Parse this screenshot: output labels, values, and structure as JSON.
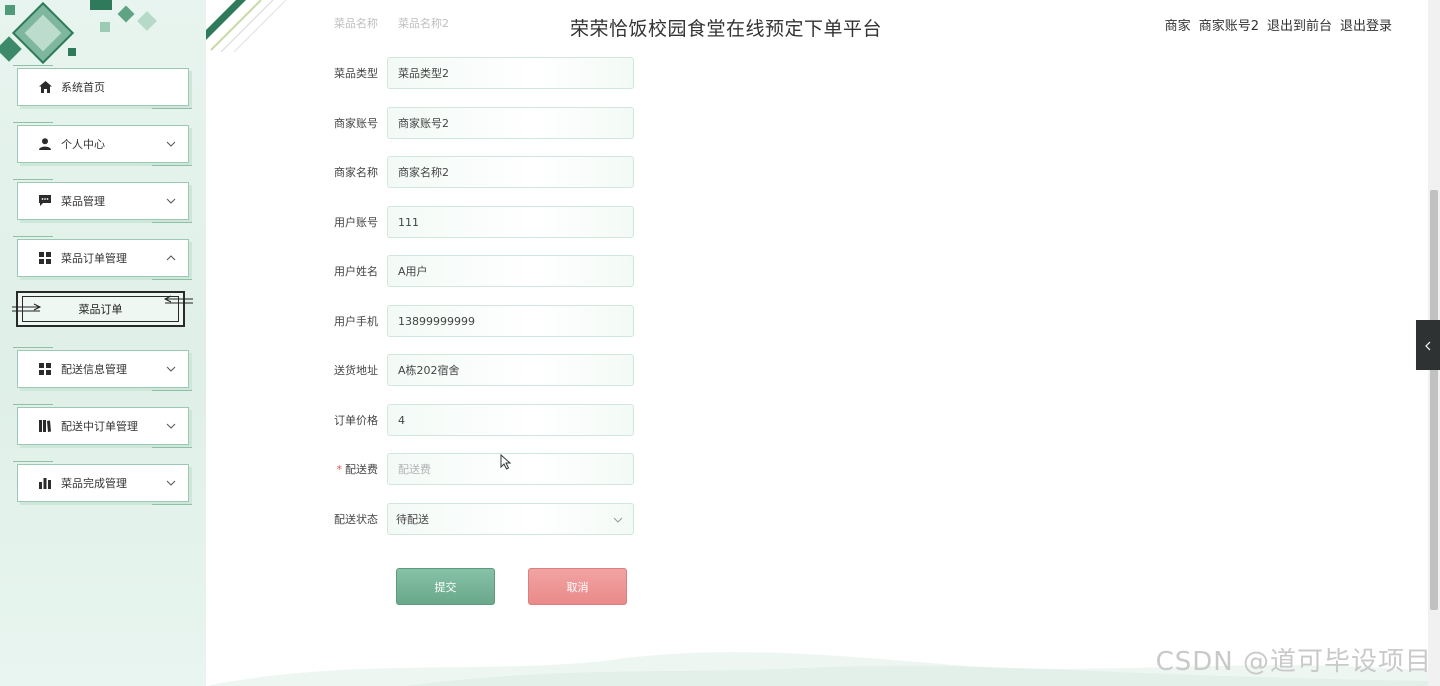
{
  "header": {
    "title": "荣荣恰饭校园食堂在线预定下单平台",
    "role": "商家",
    "account": "商家账号2",
    "front_link": "退出到前台",
    "logout_link": "退出登录"
  },
  "sidebar": {
    "items": [
      {
        "label": "系统首页",
        "icon": "home-icon"
      },
      {
        "label": "个人中心",
        "icon": "user-icon"
      },
      {
        "label": "菜品管理",
        "icon": "chat-icon"
      },
      {
        "label": "菜品订单管理",
        "icon": "grid-icon"
      },
      {
        "label": "配送信息管理",
        "icon": "grid-icon"
      },
      {
        "label": "配送中订单管理",
        "icon": "book-icon"
      },
      {
        "label": "菜品完成管理",
        "icon": "bar-chart-icon"
      }
    ],
    "sub_item": "菜品订单"
  },
  "form": {
    "ghost": {
      "label": "菜品名称",
      "value": "菜品名称2"
    },
    "fields": [
      {
        "label": "菜品类型",
        "value": "菜品类型2"
      },
      {
        "label": "商家账号",
        "value": "商家账号2"
      },
      {
        "label": "商家名称",
        "value": "商家名称2"
      },
      {
        "label": "用户账号",
        "value": "111"
      },
      {
        "label": "用户姓名",
        "value": "A用户"
      },
      {
        "label": "用户手机",
        "value": "13899999999"
      },
      {
        "label": "送货地址",
        "value": "A栋202宿舍"
      },
      {
        "label": "订单价格",
        "value": "4"
      }
    ],
    "delivery_fee": {
      "label": "配送费",
      "placeholder": "配送费",
      "required_mark": "*"
    },
    "delivery_status": {
      "label": "配送状态",
      "value": "待配送"
    },
    "submit_label": "提交",
    "cancel_label": "取消"
  },
  "watermark": "CSDN @道可毕设项目",
  "colors": {
    "accent": "#6aa88b",
    "cancel": "#e98a8a",
    "sidebar_bg": "#e8f4ef"
  }
}
